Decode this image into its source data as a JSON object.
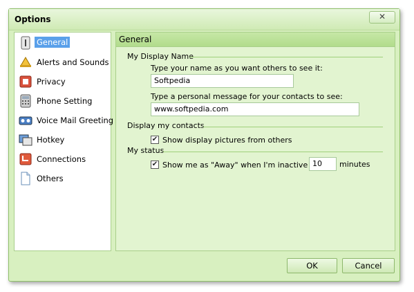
{
  "window": {
    "title": "Options",
    "close_glyph": "✕"
  },
  "sidebar": {
    "items": [
      {
        "label": "General",
        "icon": "general-icon",
        "selected": true
      },
      {
        "label": "Alerts and Sounds",
        "icon": "alerts-icon"
      },
      {
        "label": "Privacy",
        "icon": "privacy-icon"
      },
      {
        "label": "Phone Setting",
        "icon": "phone-icon"
      },
      {
        "label": "Voice Mail Greeting",
        "icon": "voicemail-icon"
      },
      {
        "label": "Hotkey",
        "icon": "hotkey-icon"
      },
      {
        "label": "Connections",
        "icon": "connections-icon"
      },
      {
        "label": "Others",
        "icon": "others-icon"
      }
    ]
  },
  "content": {
    "header": "General",
    "display_name": {
      "group": "My Display Name",
      "name_label": "Type your name as you want others to see it:",
      "name_value": "Softpedia",
      "message_label": "Type a personal message for your contacts to see:",
      "message_value": "www.softpedia.com"
    },
    "contacts": {
      "group": "Display my contacts",
      "show_pictures_label": "Show display pictures from others",
      "show_pictures_checked": true
    },
    "status": {
      "group": "My status",
      "away_label": "Show me as \"Away\" when I'm inactive for",
      "away_checked": true,
      "away_minutes": "10",
      "minutes_label": "minutes"
    }
  },
  "footer": {
    "ok_label": "OK",
    "cancel_label": "Cancel"
  },
  "colors": {
    "accent": "#5aa0ea",
    "window_bg": "#d8f0c0",
    "border": "#8fbf6a"
  }
}
